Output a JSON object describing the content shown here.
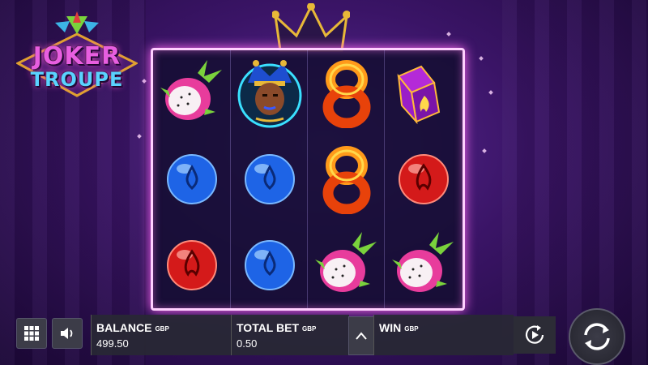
{
  "game": {
    "logo_line1": "JOKER",
    "logo_line2": "TROUPE"
  },
  "reels": [
    [
      "dragonfruit",
      "water-orb",
      "fire-orb"
    ],
    [
      "jester",
      "water-orb",
      "water-orb"
    ],
    [
      "flame-eight",
      "flame-eight",
      "dragonfruit"
    ],
    [
      "flame-dice",
      "fire-orb",
      "dragonfruit"
    ]
  ],
  "controls": {
    "menu_icon": "grid-icon",
    "sound_icon": "speaker-icon",
    "autoplay_icon": "autoplay-icon",
    "spin_icon": "spin-icon",
    "bet_adjust_icon": "chevron-up-icon"
  },
  "panel": {
    "balance_label": "BALANCE",
    "balance_currency": "GBP",
    "balance_value": "499.50",
    "bet_label": "TOTAL BET",
    "bet_currency": "GBP",
    "bet_value": "0.50",
    "win_label": "WIN",
    "win_currency": "GBP"
  },
  "colors": {
    "frame_glow": "#ff6af0",
    "water_orb": "#1e64e6",
    "fire_orb": "#d41a1a",
    "flame": "#ff9a1a"
  }
}
